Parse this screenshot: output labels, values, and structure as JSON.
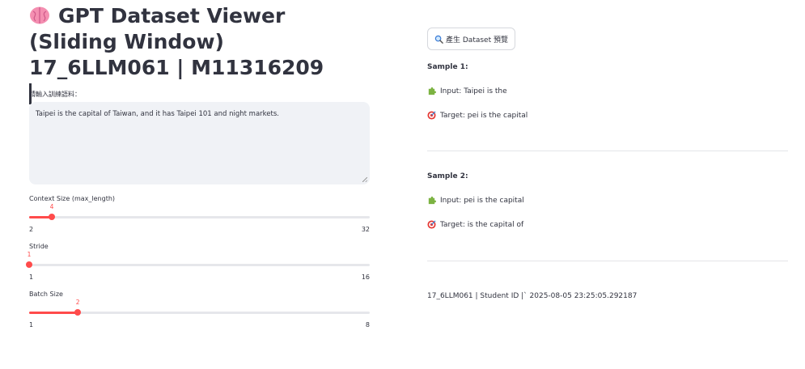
{
  "app": {
    "title": "GPT Dataset Viewer (Sliding Window) 17_6LLM061 | M11316209",
    "title_icon": "brain-icon"
  },
  "input": {
    "label": "請輸入訓練語料：",
    "value": "Taipei is the capital of Taiwan, and it has Taipei 101 and night markets."
  },
  "sliders": {
    "context_size": {
      "label": "Context Size (max_length)",
      "min": 2,
      "max": 32,
      "value": 4
    },
    "stride": {
      "label": "Stride",
      "min": 1,
      "max": 16,
      "value": 1
    },
    "batch_size": {
      "label": "Batch Size",
      "min": 1,
      "max": 8,
      "value": 2
    }
  },
  "actions": {
    "preview_label": "產生 Dataset 預覽",
    "preview_icon": "magnifier-icon"
  },
  "samples": [
    {
      "title": "Sample 1:",
      "input": "Input: Taipei is the",
      "target": "Target: pei is the capital"
    },
    {
      "title": "Sample 2:",
      "input": "Input: pei is the capital",
      "target": "Target: is the capital of"
    }
  ],
  "footer": {
    "text": "17_6LLM061 | Student ID |` 2025-08-05 23:25:05.292187"
  },
  "colors": {
    "accent": "#ff4b4b",
    "text": "#31333f",
    "input_bg": "#f0f2f6"
  }
}
